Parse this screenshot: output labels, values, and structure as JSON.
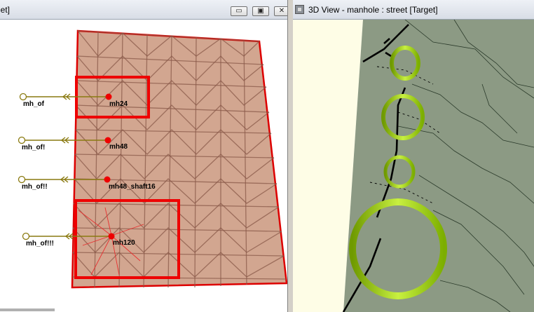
{
  "plan_window": {
    "title": "get]",
    "buttons": {
      "minimize": "▭",
      "maximize": "▣",
      "close": "✕"
    },
    "manholes": [
      {
        "id": "mh24",
        "outfall": "mh_of"
      },
      {
        "id": "mh48",
        "outfall": "mh_of!"
      },
      {
        "id": "mh48_shaft16",
        "outfall": "mh_of!!"
      },
      {
        "id": "mh120",
        "outfall": "mh_of!!!"
      }
    ]
  },
  "view3d_window": {
    "title": "3D View - manhole : street  [Target]"
  },
  "colors": {
    "surface_fill": "#d2a690",
    "surface_outline": "#dd0000",
    "selection_box": "#ee0000",
    "manhole_node": "#ee0000",
    "pipe": "#8a7a10",
    "ground_3d": "#8c9a84",
    "ring_3d": "#9ad400",
    "sky_strip": "#fefde6"
  }
}
